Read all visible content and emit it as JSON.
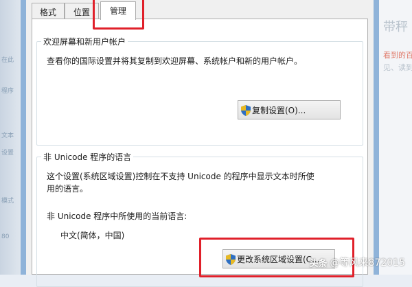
{
  "tabs": [
    {
      "label": "格式"
    },
    {
      "label": "位置"
    },
    {
      "label": "管理",
      "active": true
    }
  ],
  "welcome_group": {
    "title": "欢迎屏幕和新用户帐户",
    "description": "查看你的国际设置并将其复制到欢迎屏幕、系统帐户和新的用户帐户。",
    "button": "复制设置(O)..."
  },
  "unicode_group": {
    "title": "非 Unicode 程序的语言",
    "description_line1": "这个设置(系统区域设置)控制在不支持 Unicode 的程序中显示文本时所使",
    "description_line2": "用的语言。",
    "current_label": "非 Unicode 程序中所使用的当前语言:",
    "current_value": "中文(简体，中国)",
    "button": "更改系统区域设置(C..."
  },
  "background": {
    "right_texts": [
      "带秤",
      "看到的百度",
      "见、读到"
    ],
    "left_texts": [
      "在此",
      "程序",
      "文本",
      "设置",
      "模式",
      "80"
    ]
  },
  "watermark": {
    "logo": "头条",
    "text": "@等风来872015"
  },
  "colors": {
    "highlight": "#e0202a",
    "frame": "#8fb3d9"
  }
}
